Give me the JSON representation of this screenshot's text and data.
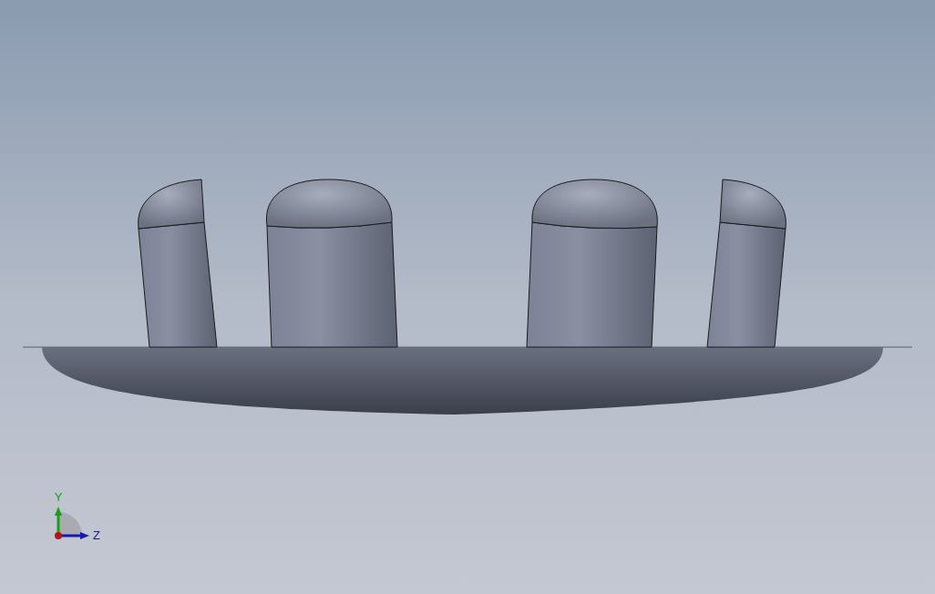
{
  "viewport": {
    "triad": {
      "axes": [
        {
          "label": "Y",
          "color": "#18a018",
          "kind": "vertical"
        },
        {
          "label": "Z",
          "color": "#1818b0",
          "kind": "horizontal"
        }
      ]
    }
  }
}
